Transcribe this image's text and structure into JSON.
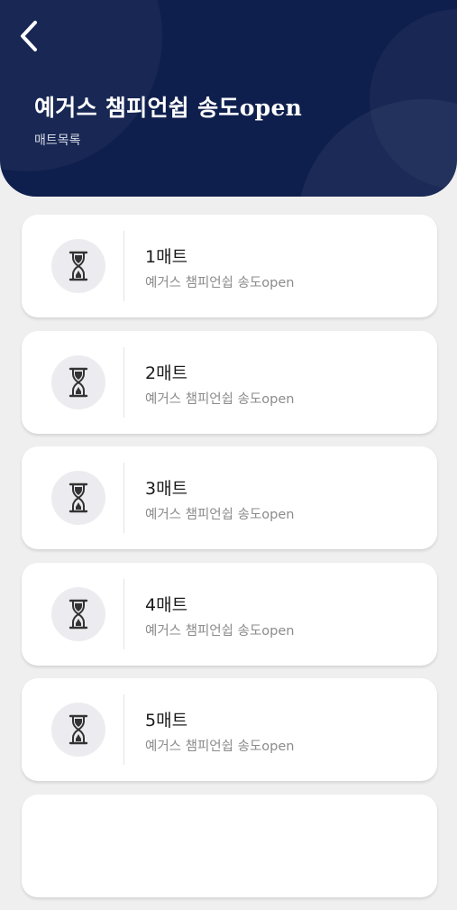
{
  "header": {
    "title": "예거스 챔피언쉽 송도open",
    "subtitle": "매트목록",
    "back_icon": "chevron-left-icon",
    "background_color": "#0f1f4d"
  },
  "mats": [
    {
      "name": "1매트",
      "tournament": "예거스 챔피언쉽 송도open",
      "icon": "hourglass-icon"
    },
    {
      "name": "2매트",
      "tournament": "예거스 챔피언쉽 송도open",
      "icon": "hourglass-icon"
    },
    {
      "name": "3매트",
      "tournament": "예거스 챔피언쉽 송도open",
      "icon": "hourglass-icon"
    },
    {
      "name": "4매트",
      "tournament": "예거스 챔피언쉽 송도open",
      "icon": "hourglass-icon"
    },
    {
      "name": "5매트",
      "tournament": "예거스 챔피언쉽 송도open",
      "icon": "hourglass-icon"
    }
  ]
}
